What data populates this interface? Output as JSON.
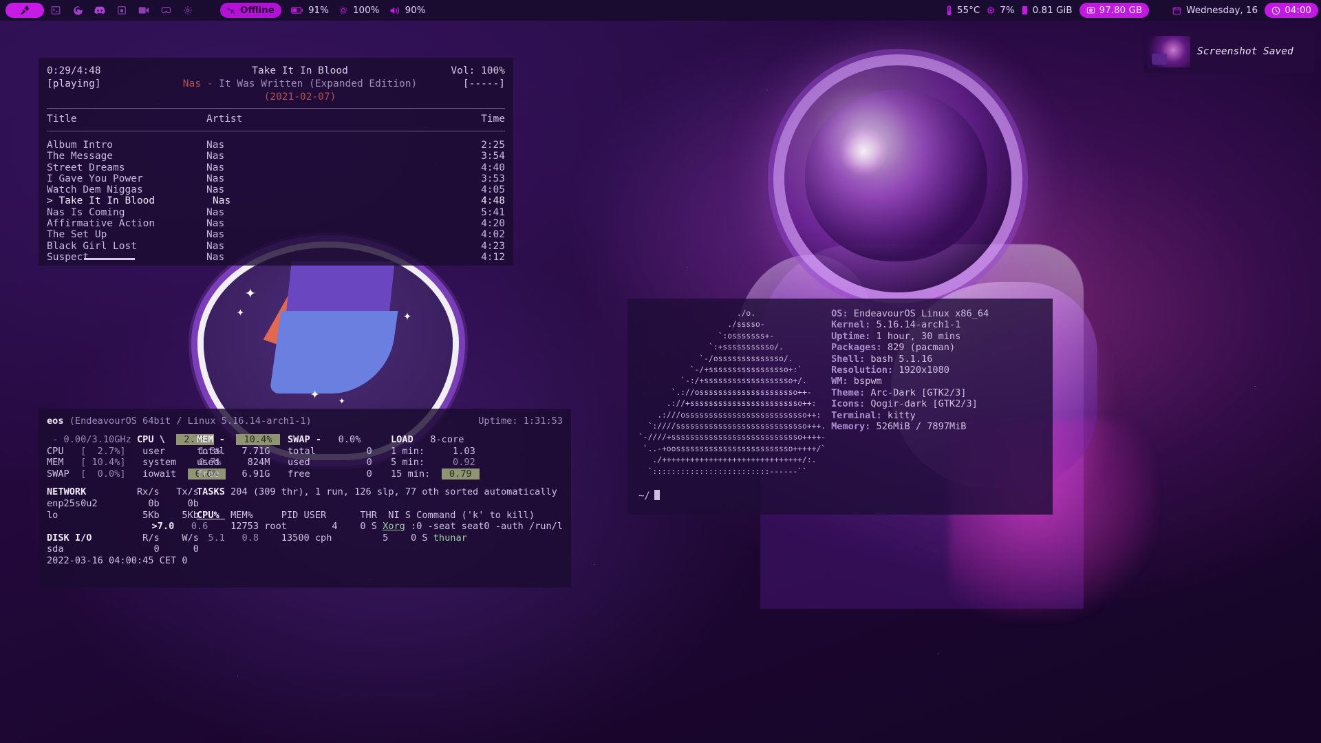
{
  "bar": {
    "launcher_icon": "rocket-icon",
    "workspace_icons": [
      "terminal-icon",
      "firefox-icon",
      "discord-icon",
      "music-icon",
      "video-icon",
      "games-icon",
      "settings-icon"
    ],
    "network": {
      "icon": "wifi-off-icon",
      "label": "Offline"
    },
    "battery": {
      "icon": "battery-icon",
      "value": "91%"
    },
    "brightness": {
      "icon": "brightness-icon",
      "value": "100%"
    },
    "volume": {
      "icon": "volume-icon",
      "value": "90%"
    },
    "temperature": {
      "icon": "thermometer-icon",
      "value": "55°C"
    },
    "cpu": {
      "icon": "cpu-icon",
      "value": "7%"
    },
    "memory": {
      "icon": "memory-icon",
      "value": "0.81 GiB"
    },
    "disk": {
      "icon": "harddisk-icon",
      "value": "97.80 GB"
    },
    "date": {
      "icon": "calendar-icon",
      "value": "Wednesday, 16"
    },
    "time": {
      "icon": "clock-icon",
      "value": "04:00"
    }
  },
  "notification": {
    "icon": "screenshot-thumbnail",
    "text": "Screenshot Saved"
  },
  "player": {
    "elapsed_total": "0:29/4:48",
    "state": "[playing]",
    "now_playing_title": "Take It In Blood",
    "volume": "Vol: 100%",
    "artist": "Nas",
    "dash": "-",
    "album": "It Was Written (Expanded Edition)",
    "album_date": "(2021-02-07)",
    "mode": "[-----]",
    "columns": {
      "title": "Title",
      "artist": "Artist",
      "time": "Time"
    },
    "tracks": [
      {
        "title": "Album Intro",
        "artist": "Nas",
        "time": "2:25",
        "current": false
      },
      {
        "title": "The Message",
        "artist": "Nas",
        "time": "3:54",
        "current": false
      },
      {
        "title": "Street Dreams",
        "artist": "Nas",
        "time": "4:40",
        "current": false
      },
      {
        "title": "I Gave You Power",
        "artist": "Nas",
        "time": "3:53",
        "current": false
      },
      {
        "title": "Watch Dem Niggas",
        "artist": "Nas",
        "time": "4:05",
        "current": false
      },
      {
        "title": "> Take It In Blood",
        "artist": "Nas",
        "time": "4:48",
        "current": true
      },
      {
        "title": "Nas Is Coming",
        "artist": "Nas",
        "time": "5:41",
        "current": false
      },
      {
        "title": "Affirmative Action",
        "artist": "Nas",
        "time": "4:20",
        "current": false
      },
      {
        "title": "The Set Up",
        "artist": "Nas",
        "time": "4:02",
        "current": false
      },
      {
        "title": "Black Girl Lost",
        "artist": "Nas",
        "time": "4:23",
        "current": false
      },
      {
        "title": "Suspect",
        "artist": "Nas",
        "time": "4:12",
        "current": false
      }
    ]
  },
  "htop": {
    "host": "eos",
    "host_detail": "(EndeavourOS 64bit / Linux 5.16.14-arch1-1)",
    "uptime_label": "Uptime: 1:31:53",
    "freq": " - 0.00/3.10GHz",
    "cpu_label": "CPU \\",
    "cpu_pct": "2.7%",
    "mem_label": "MEM -",
    "mem_pct": "10.4%",
    "swap_label": "SWAP -",
    "swap_pct": "0.0%",
    "load_label": "LOAD",
    "cores": "8-core",
    "gauges": [
      {
        "name": "CPU",
        "value": "[  2.7%]"
      },
      {
        "name": "MEM",
        "value": "[ 10.4%]"
      },
      {
        "name": "SWAP",
        "value": "[  0.0%]"
      }
    ],
    "cpu_breakdown": [
      {
        "name": "user",
        "value": "1.3%"
      },
      {
        "name": "system",
        "value": "0.7%"
      },
      {
        "name": "iowait",
        "value": "0.6%"
      }
    ],
    "mem_stats": [
      {
        "name": "total",
        "value": "7.71G"
      },
      {
        "name": "used",
        "value": "824M"
      },
      {
        "name": "free",
        "value": "6.91G"
      }
    ],
    "swap_stats": [
      {
        "name": "total",
        "value": "0"
      },
      {
        "name": "used",
        "value": "0"
      },
      {
        "name": "free",
        "value": "0"
      }
    ],
    "load_stats": [
      {
        "name": "1 min:",
        "value": "1.03"
      },
      {
        "name": "5 min:",
        "value": "0.92"
      },
      {
        "name": "15 min:",
        "value": "0.79"
      }
    ],
    "network_header": {
      "title": "NETWORK",
      "rx": "Rx/s",
      "tx": "Tx/s"
    },
    "network_rows": [
      {
        "iface": "enp25s0u2",
        "rx": "0b",
        "tx": "0b"
      },
      {
        "iface": "lo",
        "rx": "5Kb",
        "tx": "5Kb"
      }
    ],
    "disk_header": {
      "title": "DISK I/O",
      "r": "R/s",
      "w": "W/s"
    },
    "disk_rows": [
      {
        "dev": "sda",
        "r": "0",
        "w": "0"
      }
    ],
    "clock": "2022-03-16 04:00:45 CET 0",
    "tasks_label": "TASKS",
    "tasks_text": "204 (309 thr), 1 run, 126 slp, 77 oth sorted automatically",
    "proc_columns": "CPU%  MEM%     PID USER      THR  NI S Command ('k' to kill)",
    "processes": [
      {
        "cpu": ">7.0",
        "mem": "0.6",
        "pid": "12753",
        "user": "root",
        "thr": "4",
        "ni": "0",
        "s": "S",
        "cmd": "Xorg",
        "cmd_rest": " :0 -seat seat0 -auth /run/l"
      },
      {
        "cpu": "5.1",
        "mem": "0.8",
        "pid": "13500",
        "user": "cph",
        "thr": "5",
        "ni": "0",
        "s": "S",
        "cmd": "thunar",
        "cmd_rest": ""
      }
    ]
  },
  "neofetch": {
    "ascii": [
      "                     ./o.",
      "                   ./sssso-",
      "                 `:osssssss+-",
      "               `:+sssssssssso/.",
      "             `-/ossssssssssssso/.",
      "           `-/+sssssssssssssssso+:`",
      "         `-:/+sssssssssssssssssso+/.",
      "       `.://osssssssssssssssssssso++-",
      "      .://+ssssssssssssssssssssssso++:",
      "    .:///ossssssssssssssssssssssssso++:",
      "  `:////ssssssssssssssssssssssssssso+++.",
      "`-////+ssssssssssssssssssssssssssso++++-",
      " `..-+oosssssssssssssssssssssssso+++++/`",
      "   ./++++++++++++++++++++++++++++++/:.",
      "  `:::::::::::::::::::::::::------``"
    ],
    "info": [
      {
        "key": "OS:",
        "value": " EndeavourOS Linux x86_64"
      },
      {
        "key": "Kernel:",
        "value": " 5.16.14-arch1-1"
      },
      {
        "key": "Uptime:",
        "value": " 1 hour, 30 mins"
      },
      {
        "key": "Packages:",
        "value": " 829 (pacman)"
      },
      {
        "key": "Shell:",
        "value": " bash 5.1.16"
      },
      {
        "key": "Resolution:",
        "value": " 1920x1080"
      },
      {
        "key": "WM:",
        "value": " bspwm"
      },
      {
        "key": "Theme:",
        "value": " Arc-Dark [GTK2/3]"
      },
      {
        "key": "Icons:",
        "value": " Qogir-dark [GTK2/3]"
      },
      {
        "key": "Terminal:",
        "value": " kitty"
      },
      {
        "key": "Memory:",
        "value": " 526MiB / 7897MiB"
      }
    ],
    "prompt": "~/"
  },
  "colors": {
    "accent": "#c81ae6",
    "bar_bg": "#1a0b30",
    "panel_bg": "rgba(26,11,48,0.80)",
    "text": "#cfc2e4",
    "artist_red": "#b5524f",
    "gauge_hl": "#8f9473"
  }
}
